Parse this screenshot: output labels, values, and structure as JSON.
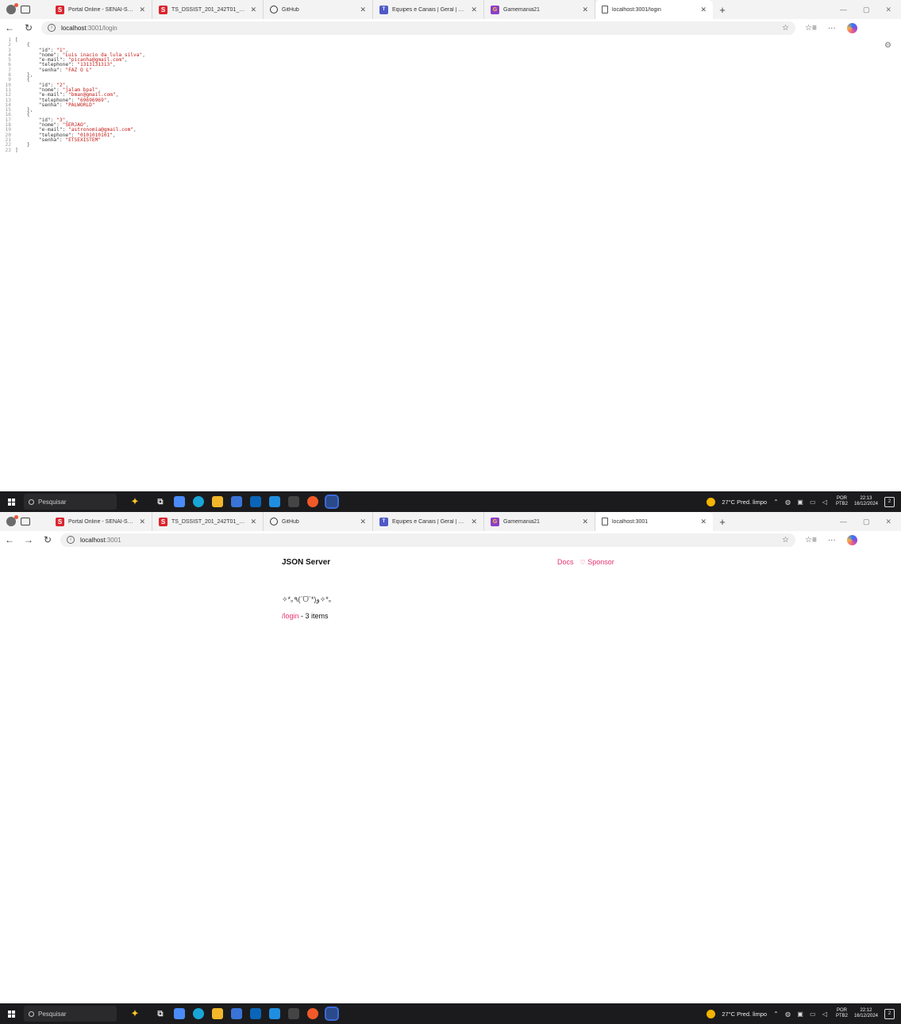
{
  "screenshots": [
    {
      "tabs": [
        {
          "title": "Portal Online - SENAI-SP - Home",
          "favicon": "S",
          "type": "senai"
        },
        {
          "title": "TS_DSSIST_201_242T01_1_IAPIS: I",
          "favicon": "S",
          "type": "senai"
        },
        {
          "title": "GitHub",
          "favicon": "",
          "type": "gh"
        },
        {
          "title": "Equipes e Canais | Geral | Micros",
          "favicon": "T",
          "type": "teams"
        },
        {
          "title": "Gamemania21",
          "favicon": "G",
          "type": "gm"
        },
        {
          "title": "localhost:3001/login",
          "favicon": "",
          "type": "page",
          "active": true
        }
      ],
      "url_host": "localhost",
      "url_path": ":3001/login",
      "json_lines": [
        {
          "n": "1",
          "text": "["
        },
        {
          "n": "2",
          "text": "    {"
        },
        {
          "n": "3",
          "key": "        \"id\": ",
          "val": "\"1\"",
          "end": ","
        },
        {
          "n": "4",
          "key": "        \"nome\": ",
          "val": "\"Luis inacio da lula silva\"",
          "end": ","
        },
        {
          "n": "5",
          "key": "        \"e-mail\": ",
          "val": "\"picanha@gmail.com\"",
          "end": ","
        },
        {
          "n": "6",
          "key": "        \"telephone\": ",
          "val": "\"1313131313\"",
          "end": ","
        },
        {
          "n": "7",
          "key": "        \"senha\": ",
          "val": "\"FAZ O L\"",
          "end": ""
        },
        {
          "n": "8",
          "text": "    },"
        },
        {
          "n": "9",
          "text": "    {"
        },
        {
          "n": "10",
          "key": "        \"id\": ",
          "val": "\"2\"",
          "end": ","
        },
        {
          "n": "11",
          "key": "        \"nome\": ",
          "val": "\"jalam bpal\"",
          "end": ","
        },
        {
          "n": "12",
          "key": "        \"e-mail\": ",
          "val": "\"bman@gmail.com\"",
          "end": ","
        },
        {
          "n": "13",
          "key": "        \"telephone\": ",
          "val": "\"69696969\"",
          "end": ","
        },
        {
          "n": "14",
          "key": "        \"senha\": ",
          "val": "\"PALWORLD\"",
          "end": ""
        },
        {
          "n": "15",
          "text": "    },"
        },
        {
          "n": "16",
          "text": "    {"
        },
        {
          "n": "17",
          "key": "        \"id\": ",
          "val": "\"3\"",
          "end": ","
        },
        {
          "n": "18",
          "key": "        \"nome\": ",
          "val": "\"SERJAO\"",
          "end": ","
        },
        {
          "n": "19",
          "key": "        \"e-mail\": ",
          "val": "\"astronomia@gmail.com\"",
          "end": ","
        },
        {
          "n": "20",
          "key": "        \"telephone\": ",
          "val": "\"0101010101\"",
          "end": ","
        },
        {
          "n": "21",
          "key": "        \"senha\": ",
          "val": "\"ETSEXISTEM\"",
          "end": ""
        },
        {
          "n": "22",
          "text": "    }"
        },
        {
          "n": "23",
          "text": "]"
        }
      ],
      "taskbar": {
        "search": "Pesquisar",
        "weather": "27°C  Pred. limpo",
        "lang_top": "POR",
        "lang_bottom": "PTB2",
        "time": "22:13",
        "date": "16/12/2024"
      }
    },
    {
      "tabs": [
        {
          "title": "Portal Online - SENAI-SP - Home",
          "favicon": "S",
          "type": "senai"
        },
        {
          "title": "TS_DSSIST_201_242T01_1_IAPIS: I",
          "favicon": "S",
          "type": "senai"
        },
        {
          "title": "GitHub",
          "favicon": "",
          "type": "gh"
        },
        {
          "title": "Equipes e Canais | Geral | Micros",
          "favicon": "T",
          "type": "teams"
        },
        {
          "title": "Gamemania21",
          "favicon": "G",
          "type": "gm"
        },
        {
          "title": "localhost:3001",
          "favicon": "",
          "type": "page",
          "active": true
        }
      ],
      "url_host": "localhost",
      "url_path": ":3001",
      "json_server": {
        "brand": "JSON Server",
        "docs": "Docs",
        "sponsor": "Sponsor",
        "kaomoji": "✧*｡٩(ˊᗜˋ*)و✧*｡",
        "resource_link": "/login",
        "resource_count": " - 3 items"
      },
      "taskbar": {
        "search": "Pesquisar",
        "weather": "27°C  Pred. limpo",
        "lang_top": "POR",
        "lang_bottom": "PTB2",
        "time": "22:12",
        "date": "16/12/2024"
      }
    }
  ],
  "colors": {
    "json_string": "#c41a16",
    "accent_pink": "#e6326e",
    "taskbar_bg": "#1b1b1d"
  }
}
